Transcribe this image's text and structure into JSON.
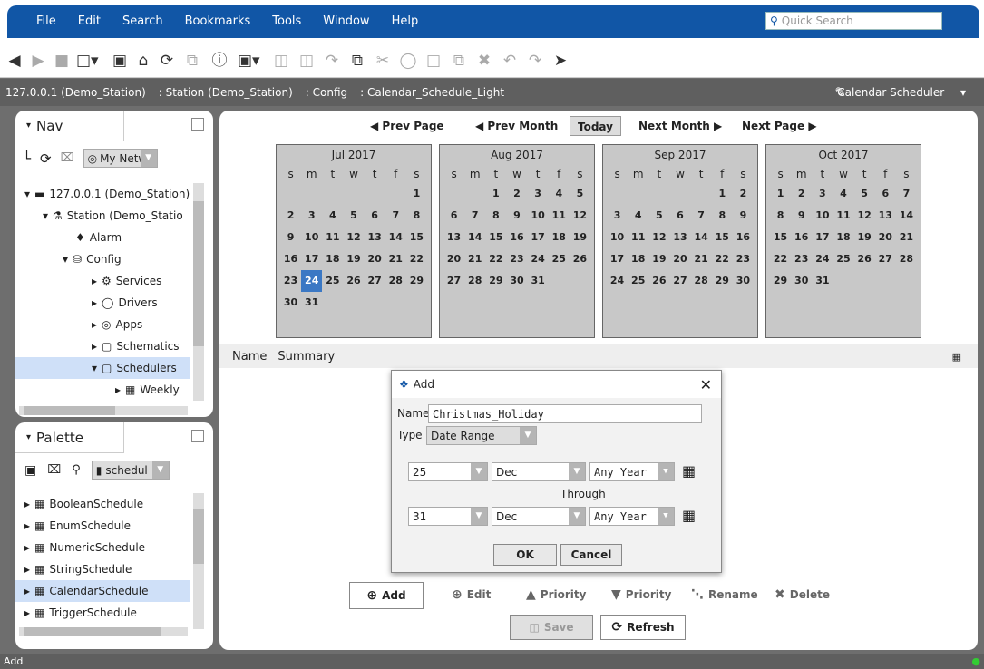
{
  "menu": [
    "File",
    "Edit",
    "Search",
    "Bookmarks",
    "Tools",
    "Window",
    "Help"
  ],
  "quick_search": "Quick Search",
  "path": {
    "host": "127.0.0.1 (Demo_Station)",
    "station": ": Station (Demo_Station)",
    "config": ": Config",
    "item": ": Calendar_Schedule_Light",
    "view": "Calendar Scheduler"
  },
  "nav": {
    "title": "Nav",
    "network": "My Netw",
    "tree": [
      "127.0.0.1 (Demo_Station)",
      "Station (Demo_Statio",
      "Alarm",
      "Config",
      "Services",
      "Drivers",
      "Apps",
      "Schematics",
      "Schedulers",
      "Weekly"
    ]
  },
  "palette": {
    "title": "Palette",
    "module": "schedul",
    "items": [
      "BooleanSchedule",
      "EnumSchedule",
      "NumericSchedule",
      "StringSchedule",
      "CalendarSchedule",
      "TriggerSchedule"
    ]
  },
  "calnav": {
    "prev_page": "Prev Page",
    "prev_month": "Prev Month",
    "today": "Today",
    "next_month": "Next Month",
    "next_page": "Next Page"
  },
  "weekdays": [
    "s",
    "m",
    "t",
    "w",
    "t",
    "f",
    "s"
  ],
  "months": [
    {
      "title": "Jul 2017",
      "offset": 6,
      "days": 31,
      "today": 24
    },
    {
      "title": "Aug 2017",
      "offset": 2,
      "days": 31
    },
    {
      "title": "Sep 2017",
      "offset": 5,
      "days": 30
    },
    {
      "title": "Oct 2017",
      "offset": 0,
      "days": 31
    }
  ],
  "list": {
    "col_name": "Name",
    "col_summary": "Summary"
  },
  "dialog": {
    "title": "Add",
    "name_label": "Name",
    "name_value": "Christmas_Holiday",
    "type_label": "Type",
    "type_value": "Date Range",
    "start_day": "25",
    "start_month": "Dec",
    "start_year": "Any Year",
    "through": "Through",
    "end_day": "31",
    "end_month": "Dec",
    "end_year": "Any Year",
    "ok": "OK",
    "cancel": "Cancel"
  },
  "actions": {
    "add": "Add",
    "edit": "Edit",
    "priority_up": "Priority",
    "priority_down": "Priority",
    "rename": "Rename",
    "delete": "Delete",
    "save": "Save",
    "refresh": "Refresh"
  },
  "status": "Add"
}
